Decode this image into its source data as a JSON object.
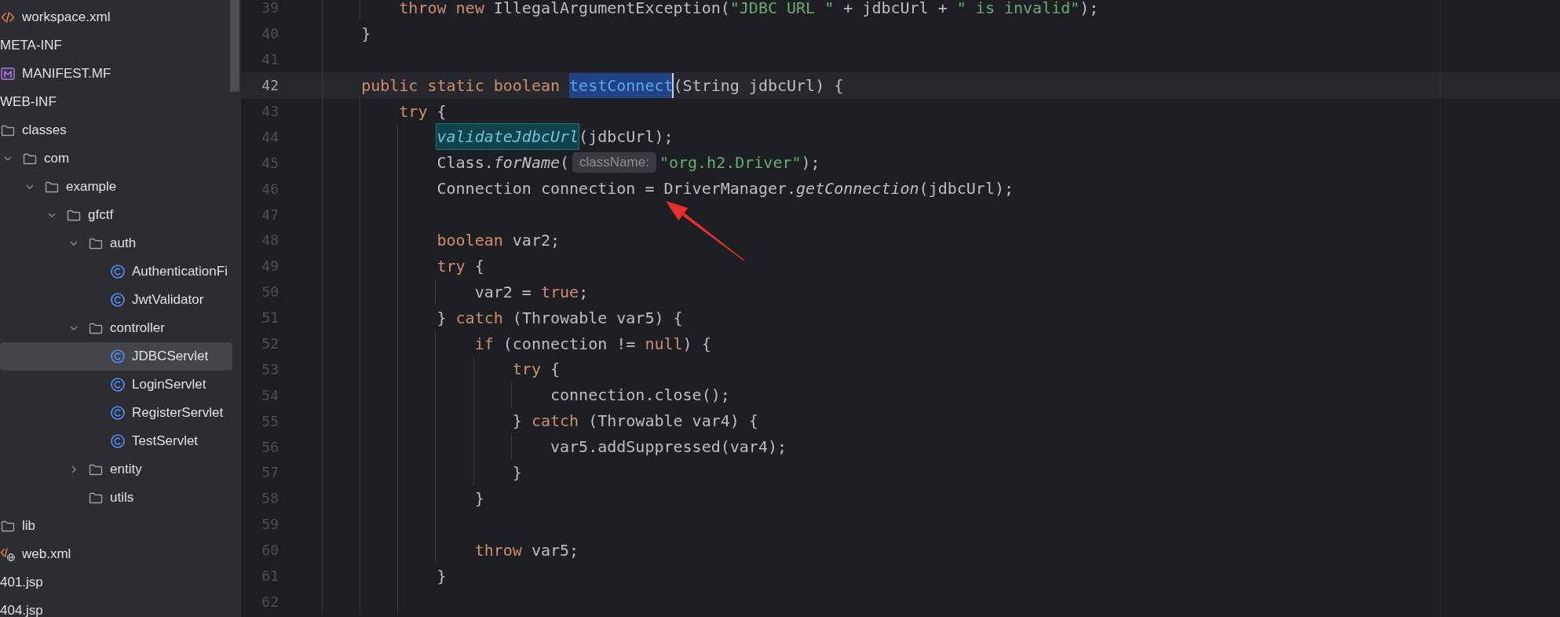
{
  "sidebar": {
    "tree": [
      {
        "children": [
          {
            "label": "workspace.xml",
            "kind": "xml",
            "selected": false
          }
        ]
      },
      {
        "label": "META-INF",
        "selected": false,
        "children": [
          {
            "label": "MANIFEST.MF",
            "kind": "manifest",
            "selected": false
          }
        ]
      },
      {
        "label": "WEB-INF",
        "selected": false,
        "children": [
          {
            "label": "classes",
            "kind": "folder",
            "selected": false,
            "children": [
              {
                "label": "com",
                "kind": "folder",
                "expanded": true,
                "selected": false,
                "children": [
                  {
                    "label": "example",
                    "kind": "folder",
                    "expanded": true,
                    "selected": false,
                    "children": [
                      {
                        "label": "gfctf",
                        "kind": "folder",
                        "expanded": true,
                        "selected": false,
                        "children": [
                          {
                            "label": "auth",
                            "kind": "folder",
                            "expanded": true,
                            "selected": false,
                            "children": [
                              {
                                "label": "AuthenticationFi",
                                "kind": "class",
                                "selected": false
                              },
                              {
                                "label": "JwtValidator",
                                "kind": "class",
                                "selected": false
                              }
                            ]
                          },
                          {
                            "label": "controller",
                            "kind": "folder",
                            "expanded": true,
                            "selected": false,
                            "children": [
                              {
                                "label": "JDBCServlet",
                                "kind": "class",
                                "selected": true
                              },
                              {
                                "label": "LoginServlet",
                                "kind": "class",
                                "selected": false
                              },
                              {
                                "label": "RegisterServlet",
                                "kind": "class",
                                "selected": false
                              },
                              {
                                "label": "TestServlet",
                                "kind": "class",
                                "selected": false
                              }
                            ]
                          },
                          {
                            "label": "entity",
                            "kind": "folder",
                            "expanded": false,
                            "selected": false
                          },
                          {
                            "label": "utils",
                            "kind": "folder",
                            "selected": false
                          }
                        ]
                      }
                    ]
                  }
                ]
              }
            ]
          },
          {
            "label": "lib",
            "kind": "folder",
            "selected": false
          },
          {
            "label": "web.xml",
            "kind": "web-xml",
            "selected": false
          }
        ]
      },
      {
        "label": "401.jsp",
        "selected": false
      },
      {
        "label": "404.jsp",
        "selected": false
      }
    ]
  },
  "editor": {
    "lines": [
      {
        "number": "39",
        "current": false,
        "tokens": [
          {
            "text": "        throw new",
            "kind": "keyword"
          },
          {
            "text": " IllegalArgumentException(",
            "kind": "plain"
          },
          {
            "text": "\"JDBC URL \"",
            "kind": "string"
          },
          {
            "text": " + jdbcUrl + ",
            "kind": "plain"
          },
          {
            "text": "\" is invalid\"",
            "kind": "string"
          },
          {
            "text": ");",
            "kind": "plain"
          }
        ]
      },
      {
        "number": "40",
        "current": false,
        "tokens": [
          {
            "text": "    }",
            "kind": "plain"
          }
        ]
      },
      {
        "number": "41",
        "current": false
      },
      {
        "number": "42",
        "current": true,
        "tokens": [
          {
            "text": "    public static boolean ",
            "kind": "keyword"
          },
          {
            "text": "testConnect",
            "kind": "selection"
          },
          {
            "text": "(String jdbcUrl) {",
            "kind": "plain"
          }
        ]
      },
      {
        "number": "43",
        "current": false,
        "tokens": [
          {
            "text": "        try",
            "kind": "keyword"
          },
          {
            "text": " {",
            "kind": "plain"
          }
        ]
      },
      {
        "number": "44",
        "current": false,
        "tokens": [
          {
            "text": "            validateJdbcUrl",
            "kind": "usage"
          },
          {
            "text": "(jdbcUrl);",
            "kind": "plain"
          }
        ]
      },
      {
        "number": "45",
        "current": false,
        "tokens": [
          {
            "text": "            Class.",
            "kind": "plain"
          },
          {
            "text": "forName",
            "kind": "italic"
          },
          {
            "text": "(",
            "kind": "plain"
          },
          {
            "text": "className:",
            "kind": "hint"
          },
          {
            "text": "\"org.h2.Driver\"",
            "kind": "string"
          },
          {
            "text": ");",
            "kind": "plain"
          }
        ]
      },
      {
        "number": "46",
        "current": false,
        "tokens": [
          {
            "text": "            Connection connection = DriverManager.",
            "kind": "plain"
          },
          {
            "text": "getConnection",
            "kind": "italic"
          },
          {
            "text": "(jdbcUrl);",
            "kind": "plain"
          }
        ]
      },
      {
        "number": "47",
        "current": false
      },
      {
        "number": "48",
        "current": false,
        "tokens": [
          {
            "text": "            boolean",
            "kind": "keyword"
          },
          {
            "text": " var2;",
            "kind": "plain"
          }
        ]
      },
      {
        "number": "49",
        "current": false,
        "tokens": [
          {
            "text": "            try",
            "kind": "keyword"
          },
          {
            "text": " {",
            "kind": "plain"
          }
        ]
      },
      {
        "number": "50",
        "current": false,
        "tokens": [
          {
            "text": "                var2 = ",
            "kind": "plain"
          },
          {
            "text": "true",
            "kind": "keyword"
          },
          {
            "text": ";",
            "kind": "plain"
          }
        ]
      },
      {
        "number": "51",
        "current": false,
        "tokens": [
          {
            "text": "            } ",
            "kind": "plain"
          },
          {
            "text": "catch",
            "kind": "keyword"
          },
          {
            "text": " (Throwable var5) {",
            "kind": "plain"
          }
        ]
      },
      {
        "number": "52",
        "current": false,
        "tokens": [
          {
            "text": "                if",
            "kind": "keyword"
          },
          {
            "text": " (connection != ",
            "kind": "plain"
          },
          {
            "text": "null",
            "kind": "keyword"
          },
          {
            "text": ") {",
            "kind": "plain"
          }
        ]
      },
      {
        "number": "53",
        "current": false,
        "tokens": [
          {
            "text": "                    try",
            "kind": "keyword"
          },
          {
            "text": " {",
            "kind": "plain"
          }
        ]
      },
      {
        "number": "54",
        "current": false,
        "tokens": [
          {
            "text": "                        connection.close();",
            "kind": "plain"
          }
        ]
      },
      {
        "number": "55",
        "current": false,
        "tokens": [
          {
            "text": "                    } ",
            "kind": "plain"
          },
          {
            "text": "catch",
            "kind": "keyword"
          },
          {
            "text": " (Throwable var4) {",
            "kind": "plain"
          }
        ]
      },
      {
        "number": "56",
        "current": false,
        "tokens": [
          {
            "text": "                        var5.addSuppressed(var4);",
            "kind": "plain"
          }
        ]
      },
      {
        "number": "57",
        "current": false,
        "tokens": [
          {
            "text": "                    }",
            "kind": "plain"
          }
        ]
      },
      {
        "number": "58",
        "current": false,
        "tokens": [
          {
            "text": "                }",
            "kind": "plain"
          }
        ]
      },
      {
        "number": "59",
        "current": false
      },
      {
        "number": "60",
        "current": false,
        "tokens": [
          {
            "text": "                throw",
            "kind": "keyword"
          },
          {
            "text": " var5;",
            "kind": "plain"
          }
        ]
      },
      {
        "number": "61",
        "current": false,
        "tokens": [
          {
            "text": "            }",
            "kind": "plain"
          }
        ]
      },
      {
        "number": "62",
        "current": false
      }
    ]
  }
}
